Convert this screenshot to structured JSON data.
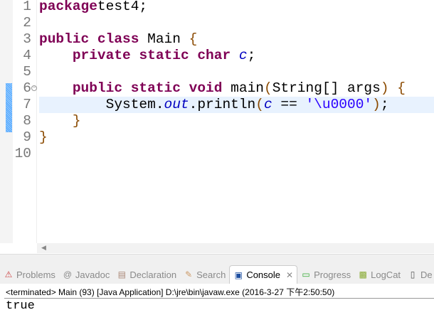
{
  "editor": {
    "current_line": 7,
    "changed_lines": [
      6,
      7,
      8
    ],
    "fold_line": 6,
    "lines": [
      [
        [
          "kw",
          "package"
        ],
        [
          "",
          "test4;"
        ]
      ],
      [],
      [
        [
          "kw",
          "public"
        ],
        [
          "",
          " "
        ],
        [
          "kw",
          "class"
        ],
        [
          "",
          " Main "
        ],
        [
          "br",
          "{"
        ]
      ],
      [
        [
          "",
          "    "
        ],
        [
          "kw",
          "private"
        ],
        [
          "",
          " "
        ],
        [
          "kw",
          "static"
        ],
        [
          "",
          " "
        ],
        [
          "kw",
          "char"
        ],
        [
          "",
          " "
        ],
        [
          "fld",
          "c"
        ],
        [
          "",
          ";"
        ]
      ],
      [],
      [
        [
          "",
          "    "
        ],
        [
          "kw",
          "public"
        ],
        [
          "",
          " "
        ],
        [
          "kw",
          "static"
        ],
        [
          "",
          " "
        ],
        [
          "kw",
          "void"
        ],
        [
          "",
          " main"
        ],
        [
          "br",
          "("
        ],
        [
          "",
          "String[] args"
        ],
        [
          "br",
          ")"
        ],
        [
          "",
          " "
        ],
        [
          "br",
          "{"
        ]
      ],
      [
        [
          "",
          "        System."
        ],
        [
          "fld",
          "out"
        ],
        [
          "",
          ".println"
        ],
        [
          "br",
          "("
        ],
        [
          "fld",
          "c"
        ],
        [
          "",
          " == "
        ],
        [
          "str",
          "'\\u0000'"
        ],
        [
          "br",
          ")"
        ],
        [
          "",
          ";"
        ]
      ],
      [
        [
          "",
          "    "
        ],
        [
          "br",
          "}"
        ]
      ],
      [
        [
          "br",
          "}"
        ]
      ],
      []
    ]
  },
  "tabs": [
    {
      "label": "Problems",
      "icon": "problems-icon",
      "glyph": "⚠",
      "color": "#c44"
    },
    {
      "label": "Javadoc",
      "icon": "at-icon",
      "glyph": "@",
      "color": "#888"
    },
    {
      "label": "Declaration",
      "icon": "declaration-icon",
      "glyph": "▤",
      "color": "#a87"
    },
    {
      "label": "Search",
      "icon": "search-icon",
      "glyph": "✎",
      "color": "#c96"
    },
    {
      "label": "Console",
      "icon": "console-icon",
      "glyph": "▣",
      "color": "#1e4fa0",
      "active": true
    },
    {
      "label": "Progress",
      "icon": "progress-icon",
      "glyph": "▭",
      "color": "#3a3"
    },
    {
      "label": "LogCat",
      "icon": "logcat-icon",
      "glyph": "▩",
      "color": "#8a3"
    },
    {
      "label": "De",
      "icon": "device-icon",
      "glyph": "▯",
      "color": "#555"
    }
  ],
  "console": {
    "status": "<terminated> Main (93) [Java Application] D:\\jre\\bin\\javaw.exe (2016-3-27 下午2:50:50)",
    "output": "true"
  }
}
